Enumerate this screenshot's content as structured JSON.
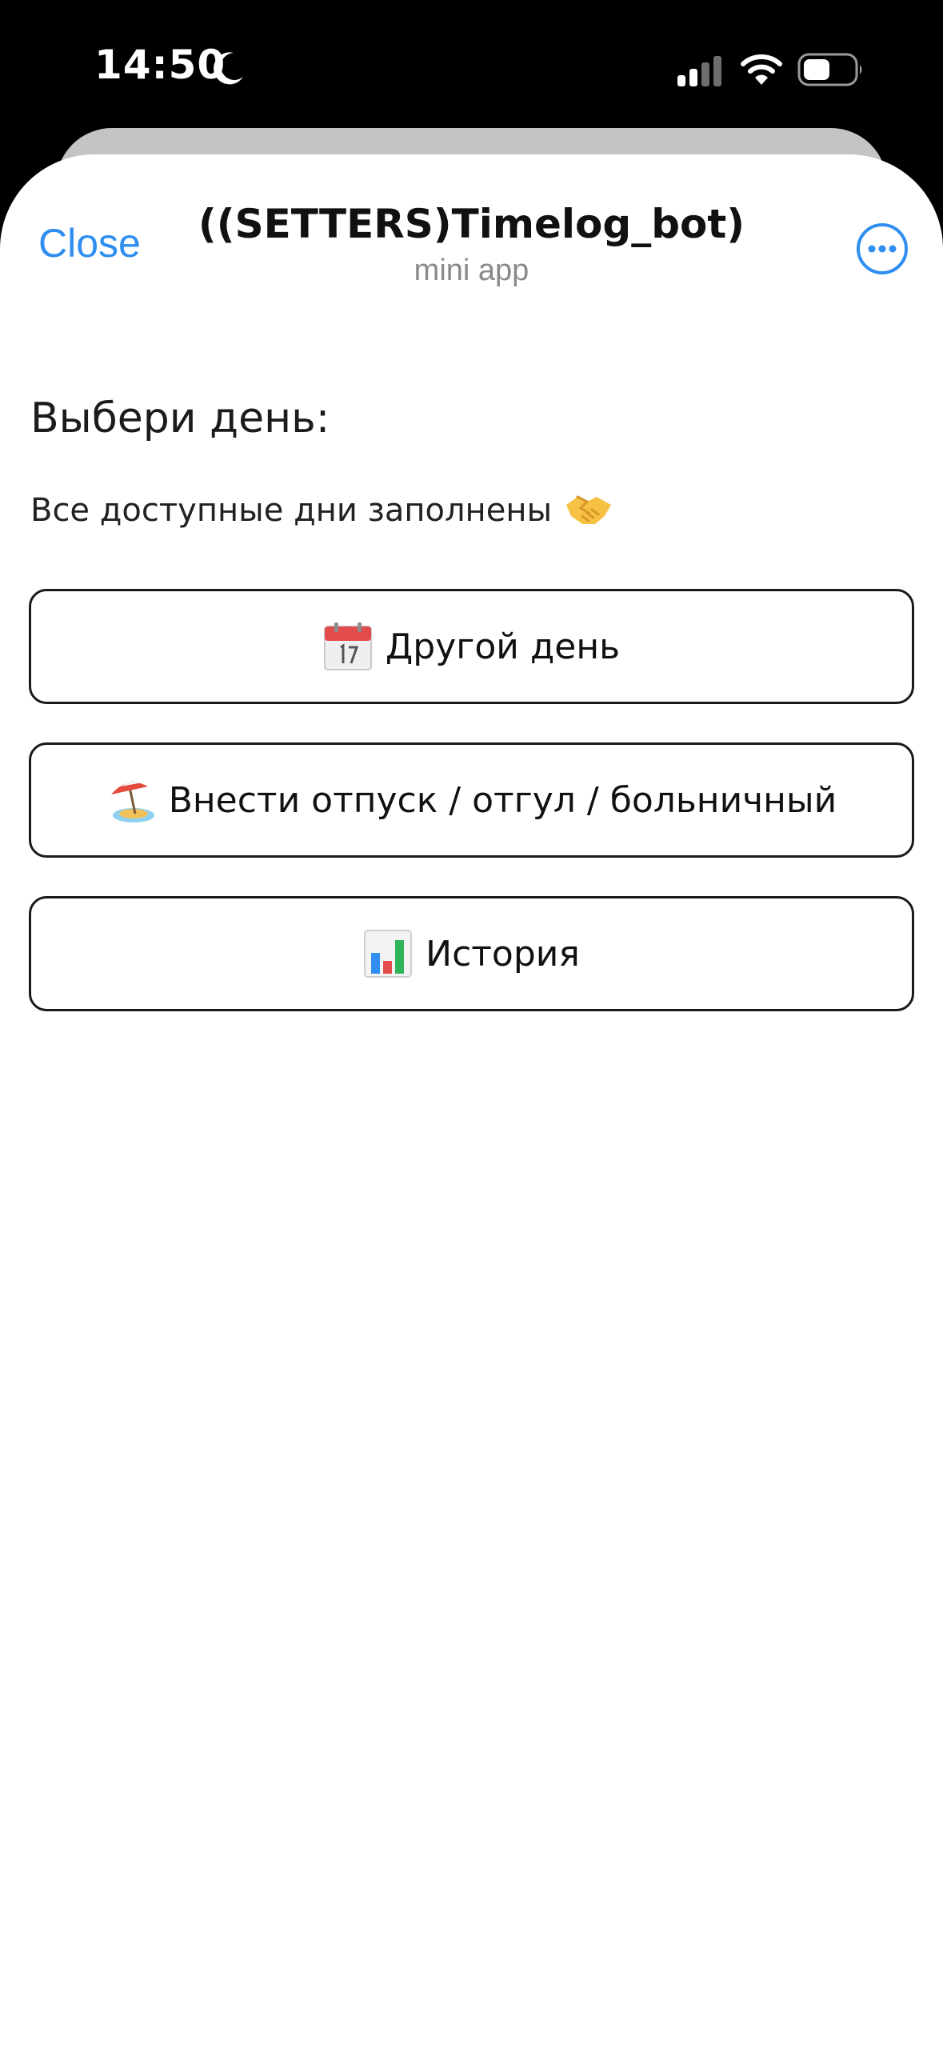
{
  "status_bar": {
    "time": "14:50",
    "icons": [
      "moon-icon",
      "signal-icon",
      "wifi-icon",
      "battery-icon"
    ]
  },
  "header": {
    "close_label": "Close",
    "title": "((SETTERS)Timelog_bot)",
    "subtitle": "mini app",
    "more_icon": "more-icon"
  },
  "main": {
    "title": "Выбери день:",
    "status_text": "Все доступные дни заполнены",
    "status_icon": "handshake-icon",
    "buttons": [
      {
        "label": "Другой день",
        "icon": "calendar-icon"
      },
      {
        "label": "Внести отпуск / отгул / больничный",
        "icon": "beach-umbrella-icon"
      },
      {
        "label": "История",
        "icon": "bar-chart-icon"
      }
    ]
  },
  "colors": {
    "accent": "#2f8ef0",
    "background": "#ffffff",
    "status_bar": "#000000",
    "button_border": "#1a1a1a"
  }
}
